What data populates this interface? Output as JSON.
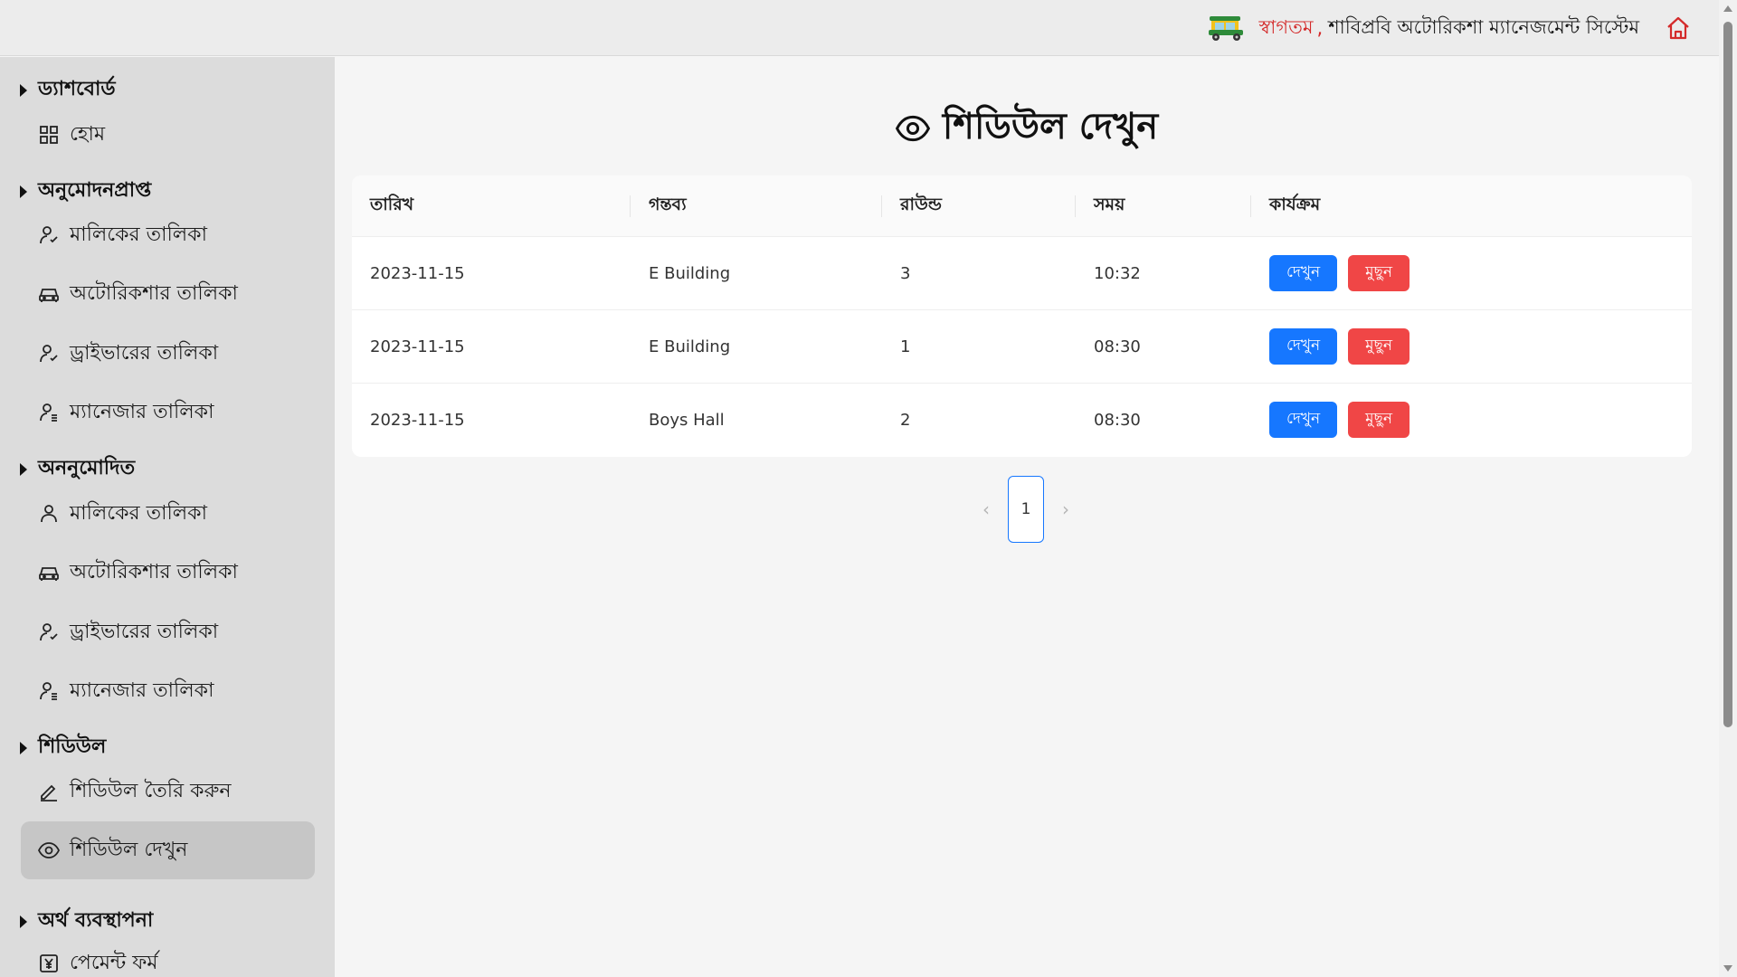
{
  "header": {
    "welcome": "স্বাগতম",
    "separator": ",",
    "system_name": "শাবিপ্রবি অটোরিকশা ম্যানেজমেন্ট সিস্টেম"
  },
  "sidebar": {
    "groups": [
      {
        "title": "ড্যাশবোর্ড",
        "items": [
          {
            "label": "হোম",
            "icon": "grid-icon"
          }
        ]
      },
      {
        "title": "অনুমোদনপ্রাপ্ত",
        "items": [
          {
            "label": "মালিকের তালিকা",
            "icon": "user-check-icon"
          },
          {
            "label": "অটোরিকশার তালিকা",
            "icon": "car-icon"
          },
          {
            "label": "ড্রাইভারের তালিকা",
            "icon": "user-check-icon"
          },
          {
            "label": "ম্যানেজার তালিকা",
            "icon": "user-settings-icon"
          }
        ]
      },
      {
        "title": "অননুমোদিত",
        "items": [
          {
            "label": "মালিকের তালিকা",
            "icon": "user-icon"
          },
          {
            "label": "অটোরিকশার তালিকা",
            "icon": "car-icon"
          },
          {
            "label": "ড্রাইভারের তালিকা",
            "icon": "user-check-icon"
          },
          {
            "label": "ম্যানেজার তালিকা",
            "icon": "user-settings-icon"
          }
        ]
      },
      {
        "title": "শিডিউল",
        "items": [
          {
            "label": "শিডিউল তৈরি করুন",
            "icon": "pencil-icon"
          },
          {
            "label": "শিডিউল দেখুন",
            "icon": "eye-icon",
            "active": true
          }
        ]
      },
      {
        "title": "অর্থ ব্যবস্থাপনা",
        "items": [
          {
            "label": "পেমেন্ট ফর্ম",
            "icon": "yen-icon"
          }
        ]
      }
    ]
  },
  "main": {
    "title": "শিডিউল দেখুন",
    "table": {
      "headers": [
        "তারিখ",
        "গন্তব্য",
        "রাউন্ড",
        "সময়",
        "কার্যক্রম"
      ],
      "rows": [
        {
          "date": "2023-11-15",
          "destination": "E Building",
          "round": "3",
          "time": "10:32"
        },
        {
          "date": "2023-11-15",
          "destination": "E Building",
          "round": "1",
          "time": "08:30"
        },
        {
          "date": "2023-11-15",
          "destination": "Boys Hall",
          "round": "2",
          "time": "08:30"
        }
      ],
      "view_label": "দেখুন",
      "delete_label": "মুছুন"
    },
    "pagination": {
      "current": "1",
      "prev": "‹",
      "next": "›"
    }
  },
  "colors": {
    "primary": "#1677ff",
    "danger": "#f04646",
    "brand_red": "#d42a2a"
  }
}
